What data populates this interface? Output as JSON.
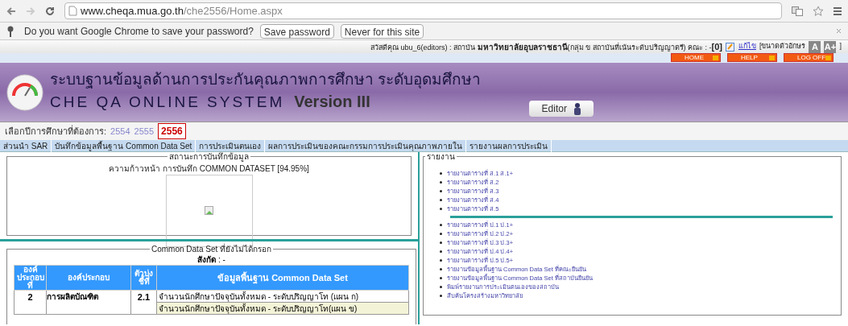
{
  "browser": {
    "url_host": "www.cheqa.mua.go.th",
    "url_path": "/che2556/Home.aspx"
  },
  "password_bar": {
    "message": "Do you want Google Chrome to save your password?",
    "buttons": [
      "Save password",
      "Never for this site"
    ]
  },
  "user_bar": {
    "greeting": "สวัสดีคุณ ubu_6(editors) : สถาบัน ",
    "institution": "มหาวิทยาลัยอุบลราชธานี",
    "detail": "(กลุ่ม ข สถาบันที่เน้นระดับปริญญาตรี) คณะ : -",
    "count": "[0]",
    "edit_link": "แก้ไข",
    "font_size_label": "[ขนาดตัวอักษร",
    "font_buttons": [
      "A",
      "A+"
    ],
    "close_bracket": "]"
  },
  "nav_buttons": [
    "HOME",
    "HELP",
    "LOG OFF"
  ],
  "header": {
    "title_th": "ระบบฐานข้อมูลด้านการประกันคุณภาพการศึกษา ระดับอุดมศึกษา",
    "title_en": "CHE QA ONLINE SYSTEM",
    "version": "Version III",
    "role": "Editor"
  },
  "years": {
    "label": "เลือกปีการศึกษาที่ต้องการ:",
    "items": [
      {
        "label": "2554",
        "selected": false
      },
      {
        "label": "2555",
        "selected": false
      },
      {
        "label": "2556",
        "selected": true
      }
    ]
  },
  "menu": [
    "ส่วนนำ SAR",
    "บันทึกข้อมูลพื้นฐาน Common Data Set",
    "การประเมินตนเอง",
    "ผลการประเมินของคณะกรรมการประเมินคุณภาพภายใน",
    "รายงานผลการประเมิน"
  ],
  "status_panel": {
    "legend": "สถานะการบันทึกข้อมูล",
    "progress": "ความก้าวหน้า การบันทึก COMMON DATASET [94.95%]"
  },
  "missing_panel": {
    "legend": "Common Data Set ที่ยังไม่ได้กรอก",
    "affiliation_label": "สังกัด",
    "affiliation_value": " : -",
    "table": {
      "columns": [
        "องค์ประกอบที่",
        "องค์ประกอบ",
        "ตัวบ่งชี้ที่",
        "ข้อมูลพื้นฐาน Common Data Set"
      ],
      "rows": [
        {
          "component_no": "2",
          "component": "การผลิตบัณฑิต",
          "indicator": "2.1",
          "items": [
            "จำนวนนักศึกษาปัจจุบันทั้งหมด - ระดับปริญญาโท  (แผน ก)",
            "จำนวนนักศึกษาปัจจุบันทั้งหมด - ระดับปริญญาโท(แผน ข)"
          ]
        }
      ]
    }
  },
  "reports_panel": {
    "legend": "รายงาน",
    "groups": [
      [
        "รายงานตารางที่ ส.1 ส.1+",
        "รายงานตารางที่ ส.2",
        "รายงานตารางที่ ส.3",
        "รายงานตารางที่ ส.4",
        "รายงานตารางที่ ส.5"
      ],
      [
        "รายงานตารางที่ ป.1  ป.1+",
        "รายงานตารางที่ ป.2  ป.2+",
        "รายงานตารางที่ ป.3  ป.3+",
        "รายงานตารางที่ ป.4  ป.4+",
        "รายงานตารางที่ ป.5  ป.5+",
        "รายงานข้อมูลพื้นฐาน Common Data Set ที่คณะยืนยัน",
        "รายงานข้อมูลพื้นฐาน Common Data Set ที่สถาบันยืนยัน",
        "พิมพ์รายงานการประเมินตนเองของสถาบัน",
        "สืบค้นโครงสร้างมหาวิทยาลัย"
      ]
    ]
  }
}
